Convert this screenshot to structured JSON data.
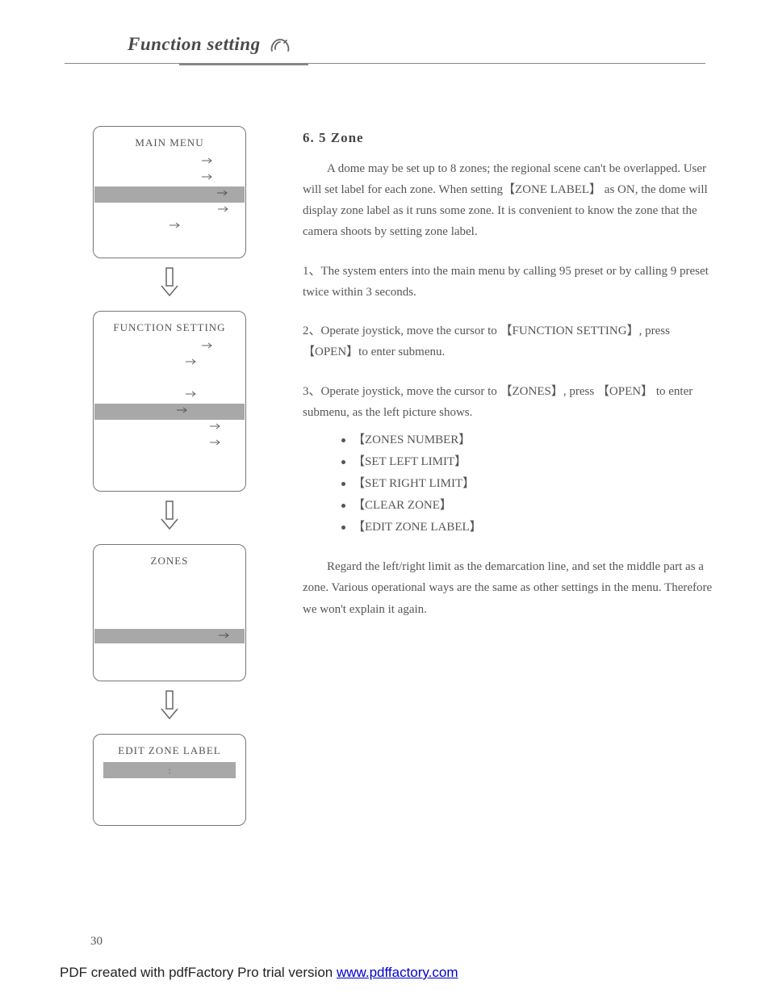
{
  "header": {
    "title": "Function setting"
  },
  "menus": {
    "main": {
      "title": "MAIN  MENU"
    },
    "function": {
      "title": "FUNCTION  SETTING"
    },
    "zones": {
      "title": "ZONES"
    },
    "edit": {
      "title": "EDIT ZONE LABEL",
      "row_text": ":"
    }
  },
  "section": {
    "heading": "6.  5   Zone",
    "intro": "A dome may be set up to 8 zones; the regional scene can't be overlapped. User will set label for each zone. When setting【ZONE LABEL】 as ON, the dome will display zone label as it runs some zone. It is convenient to know the zone that the camera shoots by setting zone  label.",
    "step1": "1、The system enters into the main menu by calling 95 preset or by calling 9 preset twice within 3 seconds.",
    "step2": "2、Operate joystick, move the cursor to 【FUNCTION SETTING】, press 【OPEN】to enter submenu.",
    "step3": "3、Operate joystick, move the cursor to 【ZONES】, press 【OPEN】 to enter submenu, as the left picture shows.",
    "bullets": {
      "b1": "【ZONES  NUMBER】",
      "b2": "【SET  LEFT  LIMIT】",
      "b3": "【SET  RIGHT LIMIT】",
      "b4": "【CLEAR  ZONE】",
      "b5": "【EDIT  ZONE  LABEL】"
    },
    "closing": "Regard the left/right limit as the demarcation line, and set the middle part as a zone. Various operational ways are the same as other settings in the menu. Therefore we won't explain it again."
  },
  "page_number": "30",
  "footer": {
    "text": "PDF created with pdfFactory Pro trial version ",
    "link_text": "www.pdffactory.com"
  }
}
